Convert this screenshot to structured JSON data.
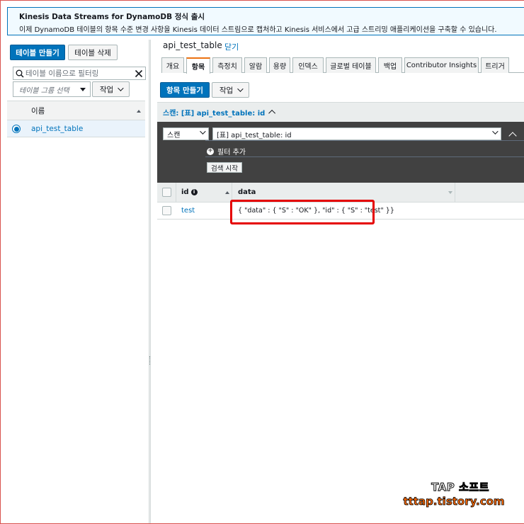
{
  "banner": {
    "title": "Kinesis Data Streams for DynamoDB 정식 출시",
    "text": "이제 DynamoDB 테이블의 항목 수준 변경 사항을 Kinesis 데이터 스트림으로 캡처하고 Kinesis 서비스에서 고급 스트리밍 애플리케이션을 구축할 수 있습니다."
  },
  "left": {
    "create_table": "테이블 만들기",
    "delete_table": "테이블 삭제",
    "filter_placeholder": "테이블 이름으로 필터링",
    "group_select": "테이블 그룹 선택",
    "actions": "작업",
    "column_name": "이름",
    "tables": [
      {
        "name": "api_test_table",
        "selected": true
      }
    ]
  },
  "right": {
    "table_title": "api_test_table",
    "close": "닫기",
    "tabs": [
      {
        "label": "개요",
        "active": false
      },
      {
        "label": "항목",
        "active": true
      },
      {
        "label": "측정치",
        "active": false
      },
      {
        "label": "알람",
        "active": false
      },
      {
        "label": "용량",
        "active": false
      },
      {
        "label": "인덱스",
        "active": false
      },
      {
        "label": "글로벌 테이블",
        "active": false
      },
      {
        "label": "백업",
        "active": false
      },
      {
        "label": "Contributor Insights",
        "active": false
      },
      {
        "label": "트리거",
        "active": false
      }
    ],
    "create_item": "항목 만들기",
    "actions": "작업",
    "scan_header": "스캔: [표] api_test_table: id",
    "scan_mode": "스캔",
    "scan_target": "[표] api_test_table: id",
    "add_filter": "필터 추가",
    "start_search": "검색 시작",
    "columns": {
      "id": "id",
      "data": "data"
    },
    "rows": [
      {
        "id": "test",
        "data": "{ \"data\" : { \"S\" : \"OK\" }, \"id\" : { \"S\" : \"test\" }}"
      }
    ]
  },
  "watermark": {
    "line1": "TAP 소프트",
    "line2": "tttap.tistory.com"
  },
  "colors": {
    "primary": "#0073bb",
    "active_tab_accent": "#ec7211",
    "highlight": "#e50000",
    "panel_dark": "#414141"
  }
}
